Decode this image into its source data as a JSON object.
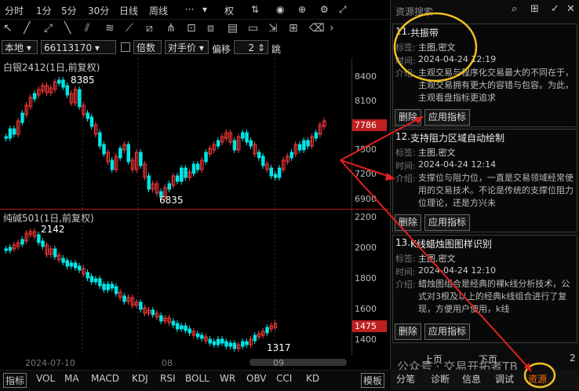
{
  "toolbar": {
    "periods": [
      "分时",
      "1分",
      "5分",
      "30分",
      "日线",
      "周线"
    ],
    "more": "···",
    "right_icon": "权"
  },
  "controls": {
    "market": "本地",
    "account": "66113170",
    "multiplier": "倍数",
    "price_mode": "对手价",
    "offset_label": "偏移",
    "offset_value": "2",
    "jump_label": "跳"
  },
  "chart_top": {
    "title": "白银2412(1日,前复权)",
    "high_label": "8385",
    "low_label": "6835",
    "last_price": "7786",
    "ticks": [
      "8400",
      "8100",
      "7800",
      "7500",
      "7200",
      "6900"
    ]
  },
  "chart_bottom": {
    "title": "纯碱501(1日,前复权)",
    "high_label": "2142",
    "low_label": "1317",
    "last_price": "1475",
    "ticks": [
      "2200",
      "2000",
      "1800",
      "1600",
      "1400"
    ]
  },
  "xaxis": {
    "labels": [
      "2024-07-10",
      "08",
      "09"
    ]
  },
  "indicator_tabs": [
    "指标",
    "VOL",
    "MA",
    "MACD",
    "KDJ",
    "RSI",
    "BOLL",
    "WR",
    "OBV",
    "CCI",
    "KD"
  ],
  "template_btn": "模板",
  "panel": {
    "header": "资源搜索",
    "cards": [
      {
        "num": "11.",
        "title": "共振带",
        "tag_label": "标签:",
        "tags": "主图,密文",
        "time_label": "时间:",
        "time": "2024-04-24 12:19",
        "desc_label": "介绍:",
        "desc": "主观交易与程序化交易最大的不同在于，主观交易拥有更大的容错与包容。为此，主观看盘指标更追求",
        "delete": "删除",
        "apply": "应用指标"
      },
      {
        "num": "12.",
        "title": "支持阻力区域自动绘制",
        "tag_label": "标签:",
        "tags": "主图,密文",
        "time_label": "时间:",
        "time": "2024-04-24 12:14",
        "desc_label": "介绍:",
        "desc": "支撑位与阻力位，一直是交易领域经常使用的交易技术。不论是传统的支撑位阻力位理论，还是方兴未",
        "delete": "删除",
        "apply": "应用指标"
      },
      {
        "num": "13.",
        "title": "K线蜡烛图图样识别",
        "tag_label": "标签:",
        "tags": "主图,密文",
        "time_label": "时间:",
        "time": "2024-04-24 12:10",
        "desc_label": "介绍:",
        "desc": "蜡烛图组合是经典的裸k线分析技术，公式对3根及以上的经典k线组合进行了复现，方便用户使用，k线",
        "delete": "删除",
        "apply": "应用指标"
      }
    ],
    "pager_prev": "上页",
    "pager_next": "下页",
    "page_num": "2",
    "watermark": "公众号 · 交易开拓者TB"
  },
  "bottom_tabs": [
    "分笔",
    "诊断",
    "信息",
    "调试",
    "资源"
  ],
  "colors": {
    "up": "#ff3b3b",
    "down": "#00e5e5",
    "accent": "#f0c020",
    "tag": "#c02020"
  }
}
